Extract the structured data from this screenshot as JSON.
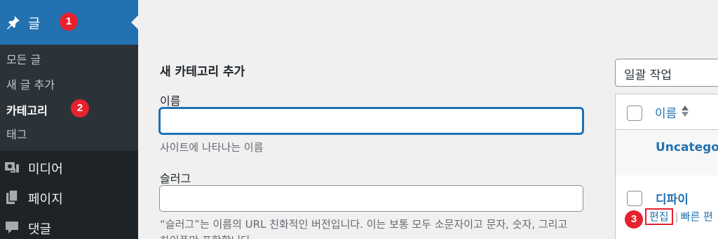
{
  "sidebar": {
    "active_menu": {
      "label": "글",
      "icon": "pin-icon",
      "badge": "1"
    },
    "submenu": [
      {
        "label": "모든 글"
      },
      {
        "label": "새 글 추가"
      },
      {
        "label": "카테고리",
        "badge": "2",
        "current": true
      },
      {
        "label": "태그"
      }
    ],
    "menu_items": [
      {
        "label": "미디어",
        "icon": "media-icon"
      },
      {
        "label": "페이지",
        "icon": "page-icon"
      },
      {
        "label": "댓글",
        "icon": "comment-icon"
      }
    ]
  },
  "form": {
    "title": "새 카테고리 추가",
    "name_label": "이름",
    "name_value": "",
    "name_hint": "사이트에 나타나는 이름",
    "slug_label": "슬러그",
    "slug_value": "",
    "slug_hint": "“슬러그”는 이름의 URL 친화적인 버전입니다. 이는 보통 모두 소문자이고 문자, 숫자, 그리고",
    "slug_hint_cont": "하이픈만 포함합니다."
  },
  "table": {
    "bulk_action": "일괄 작업",
    "column_name": "이름",
    "rows": [
      {
        "name": "Uncategor"
      },
      {
        "name": "디파이",
        "actions": {
          "edit": "편집",
          "separator": "|",
          "quick_edit": "빠른 편",
          "badge": "3"
        }
      }
    ]
  },
  "colors": {
    "sidebar_bg": "#1d2327",
    "submenu_bg": "#2c3338",
    "accent": "#2271b1",
    "badge": "#e7212e"
  }
}
